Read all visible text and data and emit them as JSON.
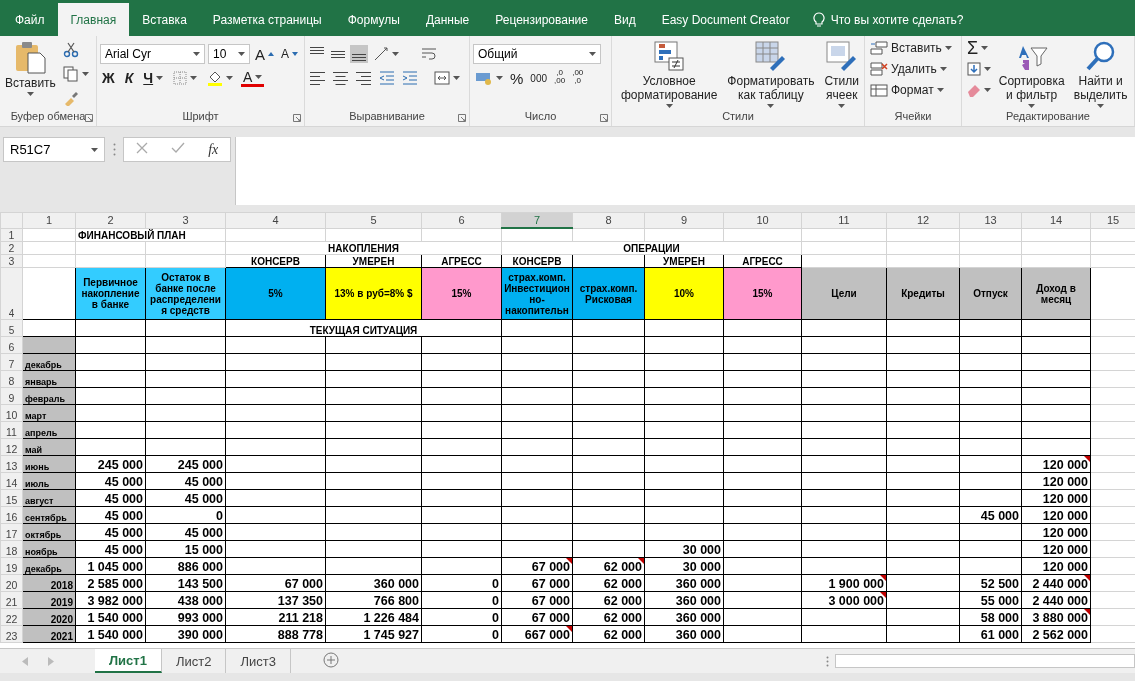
{
  "ribbon_tabs": [
    {
      "label": "Файл",
      "selected": false
    },
    {
      "label": "Главная",
      "selected": true
    },
    {
      "label": "Вставка",
      "selected": false
    },
    {
      "label": "Разметка страницы",
      "selected": false
    },
    {
      "label": "Формулы",
      "selected": false
    },
    {
      "label": "Данные",
      "selected": false
    },
    {
      "label": "Рецензирование",
      "selected": false
    },
    {
      "label": "Вид",
      "selected": false
    },
    {
      "label": "Easy Document Creator",
      "selected": false
    }
  ],
  "tell_me": {
    "placeholder": "Что вы хотите сделать?"
  },
  "ribbon": {
    "clipboard": {
      "paste": "Вставить",
      "label": "Буфер обмена"
    },
    "font": {
      "name": "Arial Cyr",
      "size": "10",
      "grow": "A",
      "shrink": "A",
      "bold": "Ж",
      "italic": "К",
      "underline": "Ч",
      "color_letter": "A",
      "label": "Шрифт"
    },
    "alignment": {
      "vertical": [
        {
          "kind": "top",
          "selected": false
        },
        {
          "kind": "middle",
          "selected": false
        },
        {
          "kind": "bottom",
          "selected": true
        }
      ],
      "horizontal": [
        {
          "kind": "left",
          "selected": false
        },
        {
          "kind": "center",
          "selected": false
        },
        {
          "kind": "right",
          "selected": false
        }
      ],
      "label": "Выравнивание"
    },
    "number": {
      "format": "Общий",
      "percent": "%",
      "thousands": "000",
      "add_decimal": [
        ",0",
        ",00"
      ],
      "remove_decimal": [
        ",00",
        ",0"
      ],
      "label": "Число"
    },
    "styles": {
      "buttons": [
        "Условное форматирование",
        "Форматировать как таблицу",
        "Стили ячеек"
      ],
      "label": "Стили"
    },
    "cells": {
      "buttons": [
        "Вставить",
        "Удалить",
        "Формат"
      ],
      "label": "Ячейки"
    },
    "editing": {
      "sum": "Σ",
      "buttons": [
        "Сортировка и фильтр",
        "Найти и выделить"
      ],
      "label": "Редактирование"
    }
  },
  "formula_bar": {
    "name_box": "R51C7",
    "function_label": "fx"
  },
  "columns": [
    {
      "label": "1",
      "selected": false
    },
    {
      "label": "2",
      "selected": false
    },
    {
      "label": "3",
      "selected": false
    },
    {
      "label": "4",
      "selected": false
    },
    {
      "label": "5",
      "selected": false
    },
    {
      "label": "6",
      "selected": false
    },
    {
      "label": "7",
      "selected": true
    },
    {
      "label": "8",
      "selected": false
    },
    {
      "label": "9",
      "selected": false
    },
    {
      "label": "10",
      "selected": false
    },
    {
      "label": "11",
      "selected": false
    },
    {
      "label": "12",
      "selected": false
    },
    {
      "label": "13",
      "selected": false
    },
    {
      "label": "14",
      "selected": false
    },
    {
      "label": "15",
      "selected": false
    }
  ],
  "rows": [
    {
      "header": "1",
      "kind": "title",
      "cells": [
        null,
        {
          "text": "ФИНАНСОВЫЙ ПЛАН",
          "note": false
        }
      ]
    },
    {
      "header": "2",
      "kind": "group",
      "cells": [
        null,
        null,
        null,
        {
          "text": "НАКОПЛЕНИЯ",
          "note": false
        },
        null,
        null,
        {
          "text": "ОПЕРАЦИИ",
          "note": false
        }
      ]
    },
    {
      "header": "3",
      "kind": "subheader",
      "cells": [
        null,
        null,
        null,
        {
          "text": "КОНСЕРВ",
          "note": false
        },
        {
          "text": "УМЕРЕН",
          "note": false
        },
        {
          "text": "АГРЕСС",
          "note": false
        },
        {
          "text": "КОНСЕРВ",
          "note": false
        },
        {
          "note": false
        },
        {
          "text": "УМЕРЕН",
          "note": false
        },
        {
          "text": "АГРЕСС",
          "note": false
        }
      ]
    },
    {
      "header": "4",
      "kind": "header",
      "cells": [
        null,
        {
          "text": "Первичное накопление в банке",
          "color": "#33ccff",
          "note": false
        },
        {
          "text": "Остаток в банке после распределения средств",
          "color": "#33ccff",
          "note": false
        },
        {
          "text": "5%",
          "color": "#00b0f0",
          "note": false
        },
        {
          "text": "13% в руб=8% $",
          "color": "#ffff00",
          "note": false
        },
        {
          "text": "15%",
          "color": "#ff99cc",
          "note": false
        },
        {
          "text": "страх.комп. Инвестиционно-накопительн",
          "color": "#00b0f0",
          "note": false
        },
        {
          "text": "страх.комп. Рисковая",
          "color": "#00b0f0",
          "note": false
        },
        {
          "text": "10%",
          "color": "#ffff00",
          "note": false
        },
        {
          "text": "15%",
          "color": "#ff99cc",
          "note": false
        },
        {
          "text": "Цели",
          "color": "#c0c0c0",
          "note": false
        },
        {
          "text": "Кредиты",
          "color": "#c0c0c0",
          "note": false
        },
        {
          "text": "Отпуск",
          "color": "#c0c0c0",
          "note": false
        },
        {
          "text": "Доход в месяц",
          "color": "#c0c0c0",
          "note": false
        }
      ]
    },
    {
      "header": "5",
      "kind": "section",
      "cells": [
        null,
        null,
        null,
        {
          "text": "ТЕКУЩАЯ СИТУАЦИЯ",
          "note": false
        }
      ]
    },
    {
      "header": "6",
      "kind": "month",
      "cells": [
        {
          "color": "#c0c0c0",
          "note": false
        }
      ]
    },
    {
      "header": "7",
      "kind": "month",
      "cells": [
        {
          "text": "декабрь",
          "color": "#c0c0c0",
          "note": false
        }
      ]
    },
    {
      "header": "8",
      "kind": "month",
      "cells": [
        {
          "text": "январь",
          "color": "#c0c0c0",
          "note": false
        }
      ]
    },
    {
      "header": "9",
      "kind": "month",
      "cells": [
        {
          "text": "февраль",
          "color": "#c0c0c0",
          "note": false
        }
      ]
    },
    {
      "header": "10",
      "kind": "month",
      "cells": [
        {
          "text": "март",
          "color": "#c0c0c0",
          "note": false
        }
      ]
    },
    {
      "header": "11",
      "kind": "month",
      "cells": [
        {
          "text": "апрель",
          "color": "#c0c0c0",
          "note": false
        }
      ]
    },
    {
      "header": "12",
      "kind": "month",
      "cells": [
        {
          "text": "май",
          "color": "#c0c0c0",
          "note": false
        }
      ]
    },
    {
      "header": "13",
      "kind": "month",
      "cells": [
        {
          "text": "июнь",
          "color": "#c0c0c0",
          "note": false
        },
        {
          "text": "245 000",
          "note": false
        },
        {
          "text": "245 000",
          "note": false
        },
        null,
        null,
        null,
        null,
        null,
        null,
        null,
        null,
        null,
        null,
        {
          "text": "120 000",
          "note": true
        }
      ]
    },
    {
      "header": "14",
      "kind": "month",
      "cells": [
        {
          "text": "июль",
          "color": "#c0c0c0",
          "note": false
        },
        {
          "text": "45 000",
          "note": false
        },
        {
          "text": "45 000",
          "note": false
        },
        null,
        null,
        null,
        null,
        null,
        null,
        null,
        null,
        null,
        null,
        {
          "text": "120 000",
          "note": false
        }
      ]
    },
    {
      "header": "15",
      "kind": "month",
      "cells": [
        {
          "text": "август",
          "color": "#c0c0c0",
          "note": false
        },
        {
          "text": "45 000",
          "note": false
        },
        {
          "text": "45 000",
          "note": false
        },
        null,
        null,
        null,
        null,
        null,
        null,
        null,
        null,
        null,
        null,
        {
          "text": "120 000",
          "note": false
        }
      ]
    },
    {
      "header": "16",
      "kind": "month",
      "cells": [
        {
          "text": "сентябрь",
          "color": "#c0c0c0",
          "note": false
        },
        {
          "text": "45 000",
          "note": false
        },
        {
          "text": "0",
          "note": false
        },
        null,
        null,
        null,
        null,
        null,
        null,
        null,
        null,
        null,
        {
          "text": "45 000",
          "note": false
        },
        {
          "text": "120 000",
          "note": false
        }
      ]
    },
    {
      "header": "17",
      "kind": "month",
      "cells": [
        {
          "text": "октябрь",
          "color": "#c0c0c0",
          "note": false
        },
        {
          "text": "45 000",
          "note": false
        },
        {
          "text": "45 000",
          "note": false
        },
        null,
        null,
        null,
        null,
        null,
        null,
        null,
        null,
        null,
        null,
        {
          "text": "120 000",
          "note": false
        }
      ]
    },
    {
      "header": "18",
      "kind": "month",
      "cells": [
        {
          "text": "ноябрь",
          "color": "#c0c0c0",
          "note": false
        },
        {
          "text": "45 000",
          "note": false
        },
        {
          "text": "15 000",
          "note": false
        },
        null,
        null,
        null,
        null,
        null,
        {
          "text": "30 000",
          "note": false
        },
        null,
        null,
        null,
        null,
        {
          "text": "120 000",
          "note": false
        }
      ]
    },
    {
      "header": "19",
      "kind": "month",
      "cells": [
        {
          "text": "декабрь",
          "color": "#c0c0c0",
          "note": false
        },
        {
          "text": "1 045 000",
          "note": false
        },
        {
          "text": "886 000",
          "note": false
        },
        null,
        null,
        null,
        {
          "text": "67 000",
          "note": true
        },
        {
          "text": "62 000",
          "note": true
        },
        {
          "text": "30 000",
          "note": false
        },
        null,
        null,
        null,
        null,
        {
          "text": "120 000",
          "note": false
        }
      ]
    },
    {
      "header": "20",
      "kind": "year",
      "cells": [
        {
          "text": "2018",
          "color": "#c0c0c0",
          "note": false
        },
        {
          "text": "2 585 000",
          "note": false
        },
        {
          "text": "143 500",
          "note": false
        },
        {
          "text": "67 000",
          "note": false
        },
        {
          "text": "360 000",
          "note": false
        },
        {
          "text": "0",
          "note": false
        },
        {
          "text": "67 000",
          "note": false
        },
        {
          "text": "62 000",
          "note": false
        },
        {
          "text": "360 000",
          "note": false
        },
        null,
        {
          "text": "1 900 000",
          "note": true
        },
        null,
        {
          "text": "52 500",
          "note": false
        },
        {
          "text": "2 440 000",
          "note": true
        }
      ]
    },
    {
      "header": "21",
      "kind": "year",
      "cells": [
        {
          "text": "2019",
          "color": "#c0c0c0",
          "note": false
        },
        {
          "text": "3 982 000",
          "note": false
        },
        {
          "text": "438 000",
          "note": false
        },
        {
          "text": "137 350",
          "note": false
        },
        {
          "text": "766 800",
          "note": false
        },
        {
          "text": "0",
          "note": false
        },
        {
          "text": "67 000",
          "note": false
        },
        {
          "text": "62 000",
          "note": false
        },
        {
          "text": "360 000",
          "note": false
        },
        null,
        {
          "text": "3 000 000",
          "note": true
        },
        null,
        {
          "text": "55 000",
          "note": false
        },
        {
          "text": "2 440 000",
          "note": false
        }
      ]
    },
    {
      "header": "22",
      "kind": "year",
      "cells": [
        {
          "text": "2020",
          "color": "#c0c0c0",
          "note": false
        },
        {
          "text": "1 540 000",
          "note": false
        },
        {
          "text": "993 000",
          "note": false
        },
        {
          "text": "211 218",
          "note": false
        },
        {
          "text": "1 226 484",
          "note": false
        },
        {
          "text": "0",
          "note": false
        },
        {
          "text": "67 000",
          "note": false
        },
        {
          "text": "62 000",
          "note": false
        },
        {
          "text": "360 000",
          "note": false
        },
        null,
        null,
        null,
        {
          "text": "58 000",
          "note": false
        },
        {
          "text": "3 880 000",
          "note": true
        }
      ]
    },
    {
      "header": "23",
      "kind": "year",
      "cells": [
        {
          "text": "2021",
          "color": "#c0c0c0",
          "note": false
        },
        {
          "text": "1 540 000",
          "note": false
        },
        {
          "text": "390 000",
          "note": false
        },
        {
          "text": "888 778",
          "note": false
        },
        {
          "text": "1 745 927",
          "note": false
        },
        {
          "text": "0",
          "note": false
        },
        {
          "text": "667 000",
          "note": true
        },
        {
          "text": "62 000",
          "note": false
        },
        {
          "text": "360 000",
          "note": false
        },
        null,
        null,
        null,
        {
          "text": "61 000",
          "note": false
        },
        {
          "text": "2 562 000",
          "note": false
        }
      ]
    }
  ],
  "sheet_tabs": [
    {
      "label": "Лист1",
      "selected": true
    },
    {
      "label": "Лист2",
      "selected": false
    },
    {
      "label": "Лист3",
      "selected": false
    }
  ]
}
